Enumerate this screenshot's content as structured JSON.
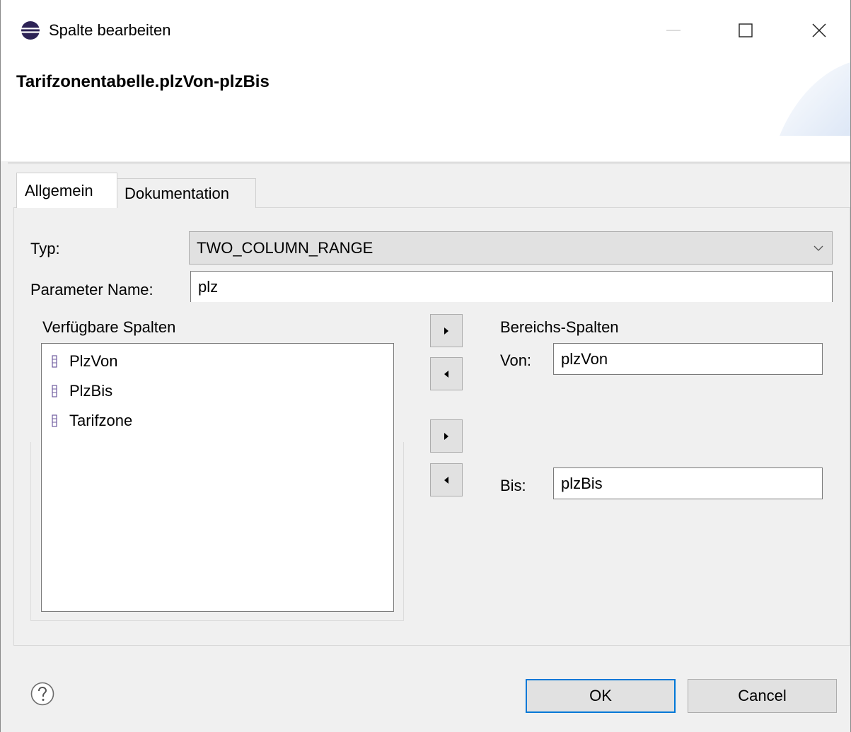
{
  "window": {
    "title": "Spalte bearbeiten",
    "icon": "eclipse-icon",
    "controls": [
      "minimize-icon",
      "maximize-icon",
      "close-icon"
    ]
  },
  "header": {
    "title": "Tarifzonentabelle.plzVon-plzBis"
  },
  "tabs": [
    {
      "label": "Allgemein",
      "active": true
    },
    {
      "label": "Dokumentation",
      "active": false
    }
  ],
  "general": {
    "type_label": "Typ:",
    "type_value": "TWO_COLUMN_RANGE",
    "param_label": "Parameter Name:",
    "param_value": "plz",
    "available_label": "Verfügbare Spalten",
    "available_columns": [
      "PlzVon",
      "PlzBis",
      "Tarifzone"
    ],
    "range_label": "Bereichs-Spalten",
    "from_label": "Von:",
    "from_value": "plzVon",
    "to_label": "Bis:",
    "to_value": "plzBis"
  },
  "buttons": {
    "ok": "OK",
    "cancel": "Cancel"
  },
  "colors": {
    "accent": "#0078d7",
    "column_icon": "#6e5a9e"
  }
}
